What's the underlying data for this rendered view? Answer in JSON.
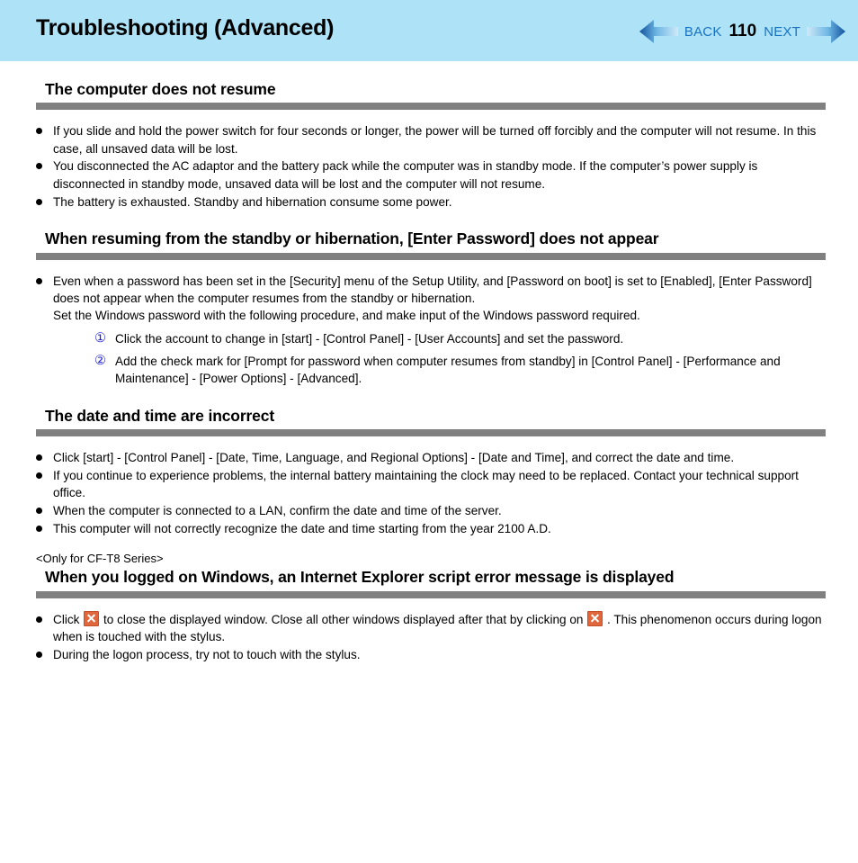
{
  "header": {
    "title": "Troubleshooting (Advanced)",
    "back_label": "BACK",
    "page_number": "110",
    "next_label": "NEXT",
    "background_color": "#ade2f7",
    "link_color": "#1973c1",
    "back_arrow_icon": "arrow-left-icon",
    "next_arrow_icon": "arrow-right-icon"
  },
  "theme": {
    "rule_color": "#808080",
    "circled_number_color": "#1f1fd0",
    "x_icon_color": "#e0663c"
  },
  "sections": [
    {
      "heading": "The computer does not resume",
      "bullets": [
        {
          "text": "If you slide and hold the power switch for four seconds or longer, the power will be turned off forcibly and the computer will not resume. In this case, all unsaved data will be lost."
        },
        {
          "text": "You disconnected the AC adaptor and the battery pack while the computer was in standby mode. If the computer’s power supply is disconnected in standby mode, unsaved data will be lost and the computer will not resume."
        },
        {
          "text": "The battery is exhausted. Standby and hibernation consume some power."
        }
      ]
    },
    {
      "heading": "When resuming from the standby or hibernation, [Enter Password] does not appear",
      "bullets": [
        {
          "text": "Even when a password has been set in the [Security] menu of the Setup Utility, and [Password on boot] is set to [Enabled], [Enter Password] does not appear when the computer resumes from the standby or hibernation.",
          "continuation": "Set the Windows password with the following procedure, and make input of the Windows password required."
        }
      ],
      "numbered": [
        {
          "marker": "①",
          "text": "Click the account to change in [start] - [Control Panel] - [User Accounts] and set the password."
        },
        {
          "marker": "②",
          "text": "Add the check mark for [Prompt for password when computer resumes from standby] in [Control Panel] - [Performance and Maintenance] - [Power Options] - [Advanced]."
        }
      ]
    },
    {
      "heading": "The date and time are incorrect",
      "bullets": [
        {
          "text": "Click [start] - [Control Panel] - [Date, Time, Language, and Regional Options] - [Date and Time], and correct the date and time."
        },
        {
          "text": "If you continue to experience problems, the internal battery maintaining the clock may need to be replaced.  Contact your technical support office."
        },
        {
          "text": "When the computer is connected to a LAN, confirm the date and time of the server."
        },
        {
          "text": "This computer will not correctly recognize the date and time starting from the year 2100 A.D."
        }
      ]
    },
    {
      "note": "<Only for CF-T8 Series>",
      "heading": "When you logged on Windows, an Internet Explorer script error message is displayed",
      "bullets_with_icons": [
        {
          "part1": "Click",
          "icon1": "close-x-icon",
          "part2": "to close the displayed window. Close all other windows displayed after that by clicking on",
          "icon2": "close-x-icon",
          "part3": ". This phenomenon occurs during logon when  is touched with the stylus."
        },
        {
          "text": "During the logon process, try not to touch  with the stylus."
        }
      ]
    }
  ]
}
